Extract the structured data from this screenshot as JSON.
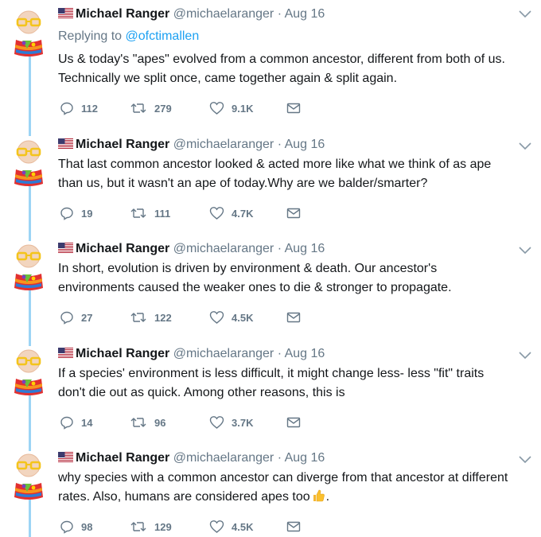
{
  "tweets": [
    {
      "name": "Michael Ranger",
      "handle": "@michaelaranger",
      "separator": "·",
      "date": "Aug 16",
      "replying_prefix": "Replying to",
      "replying_to": "@ofctimallen",
      "text_lines": [
        "Us & today's \"apes\" evolved from a common ancestor, different from both of us.",
        "Technically we split once, came together again & split again."
      ],
      "replies": "112",
      "retweets": "279",
      "likes": "9.1K"
    },
    {
      "name": "Michael Ranger",
      "handle": "@michaelaranger",
      "separator": "·",
      "date": "Aug 16",
      "text_lines": [
        "That last common ancestor looked & acted more like what we think of as ape",
        "than us, but it wasn't an ape of today.Why are we balder/smarter?"
      ],
      "replies": "19",
      "retweets": "111",
      "likes": "4.7K"
    },
    {
      "name": "Michael Ranger",
      "handle": "@michaelaranger",
      "separator": "·",
      "date": "Aug 16",
      "text_lines": [
        "In short, evolution is driven by environment & death. Our ancestor's",
        "environments caused the weaker ones to die & stronger to propagate."
      ],
      "replies": "27",
      "retweets": "122",
      "likes": "4.5K"
    },
    {
      "name": "Michael Ranger",
      "handle": "@michaelaranger",
      "separator": "·",
      "date": "Aug 16",
      "text_lines": [
        "If a species' environment is less difficult, it might change less- less \"fit\" traits",
        "don't die out as quick. Among other reasons, this is"
      ],
      "replies": "14",
      "retweets": "96",
      "likes": "3.7K"
    },
    {
      "name": "Michael Ranger",
      "handle": "@michaelaranger",
      "separator": "·",
      "date": "Aug 16",
      "text_lines": [
        "why species with a common ancestor can diverge from that ancestor at different",
        "rates. Also, humans are considered apes too"
      ],
      "line2_suffix": ".",
      "replies": "98",
      "retweets": "129",
      "likes": "4.5K"
    }
  ],
  "icons": {
    "flag": "us-flag-icon",
    "reply": "reply-icon",
    "retweet": "retweet-icon",
    "like": "heart-icon",
    "dm": "envelope-icon",
    "caret": "chevron-down-icon",
    "emoji": "thumbs-up-emoji-icon"
  },
  "colors": {
    "link": "#1da1f2",
    "muted": "#657786",
    "thread": "#9cd4f5"
  }
}
